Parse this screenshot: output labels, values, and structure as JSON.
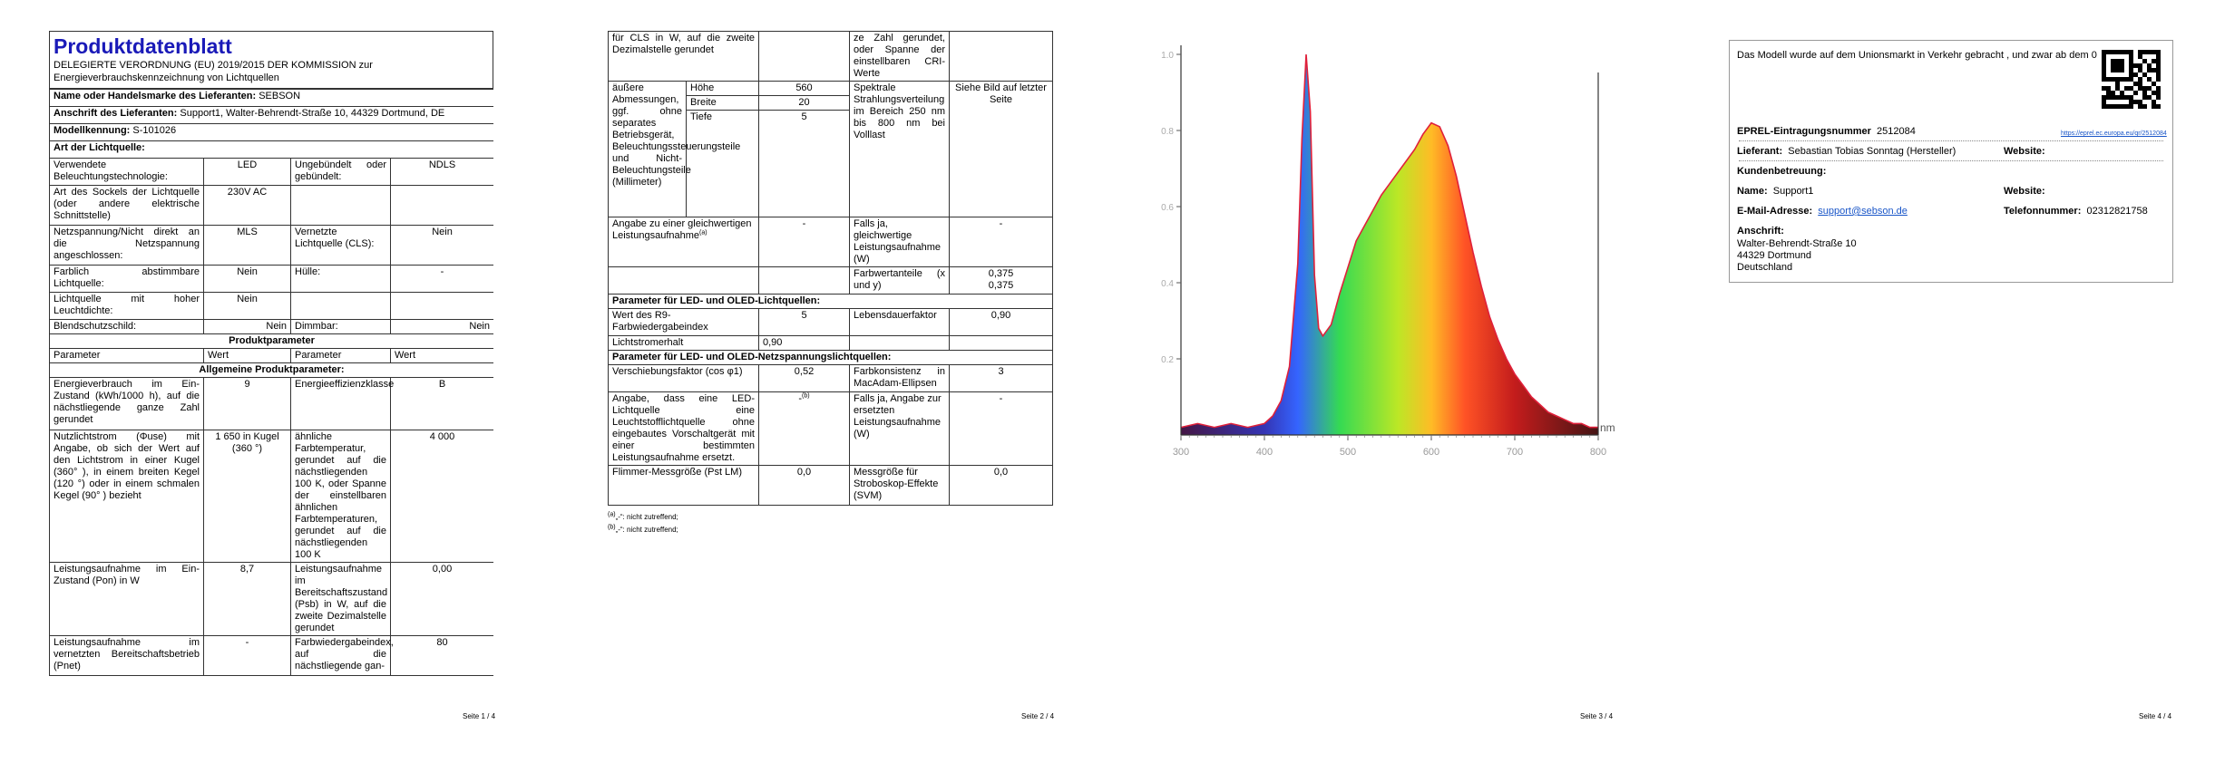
{
  "page1": {
    "title": "Produktdatenblatt",
    "regulation": "DELEGIERTE VERORDNUNG (EU) 2019/2015 DER KOMMISSION zur Energieverbrauchskennzeichnung von Lichtquellen",
    "supplier_name_label": "Name oder Handelsmarke des Lieferanten:",
    "supplier_name": "SEBSON",
    "address_label": "Anschrift des Lieferanten:",
    "address": "Support1, Walter-Behrendt-Straße 10, 44329 Dortmund, DE",
    "model_label": "Modellkennung:",
    "model": "S-101026",
    "light_type_header": "Art der Lichtquelle:",
    "rows": [
      {
        "l1": "Verwendete Beleuchtungstechnologie:",
        "v1": "LED",
        "l2": "Ungebündelt oder gebündelt:",
        "v2": "NDLS"
      },
      {
        "l1": "Art des Sockels der Lichtquelle (oder andere elektrische Schnittstelle)",
        "v1": "230V AC",
        "l2": "",
        "v2": ""
      },
      {
        "l1": "Netzspannung/Nicht direkt an die Netzspannung angeschlossen:",
        "v1": "MLS",
        "l2": "Vernetzte Lichtquelle (CLS):",
        "v2": "Nein"
      },
      {
        "l1": "Farblich abstimmbare Lichtquelle:",
        "v1": "Nein",
        "l2": "Hülle:",
        "v2": "-"
      },
      {
        "l1": "Lichtquelle mit hoher Leuchtdichte:",
        "v1": "Nein",
        "l2": "",
        "v2": ""
      },
      {
        "l1": "Blendschutzschild:",
        "v1": "Nein",
        "l2": "Dimmbar:",
        "v2": "Nein"
      }
    ],
    "product_params_header": "Produktparameter",
    "col_param": "Parameter",
    "col_value": "Wert",
    "general_params_header": "Allgemeine Produktparameter:",
    "general_rows": [
      {
        "l1": "Energieverbrauch im Ein-Zustand (kWh/1000 h), auf die nächstliegende ganze Zahl gerundet",
        "v1": "9",
        "l2": "Energieeffizienzklasse",
        "v2": "B"
      },
      {
        "l1": "Nutzlichtstrom (Φuse) mit Angabe, ob sich der Wert auf den Lichtstrom in einer Kugel (360° ), in einem breiten Kegel (120 °) oder in einem schmalen Kegel (90° ) bezieht",
        "v1": "1 650 in Kugel (360 °)",
        "l2": "ähnliche Farbtemperatur, gerundet auf die nächstliegenden 100 K, oder Spanne der einstellbaren ähnlichen Farbtemperaturen, gerundet auf die nächstliegenden 100 K",
        "v2": "4 000"
      },
      {
        "l1": "Leistungsaufnahme im Ein-Zustand (Pon) in W",
        "v1": "8,7",
        "l2": "Leistungsaufnahme im Bereitschaftszustand (Psb) in W, auf die zweite Dezimalstelle gerundet",
        "v2": "0,00"
      },
      {
        "l1": "Leistungsaufnahme im vernetzten Bereitschaftsbetrieb (Pnet)",
        "v1": "-",
        "l2": "Farbwiedergabeindex, auf die nächstliegende gan-",
        "v2": "80"
      }
    ],
    "footer": "Seite 1 / 4"
  },
  "page2": {
    "top_left": "für CLS in W, auf die zweite Dezimalstelle gerundet",
    "top_right": "ze Zahl gerundet, oder Spanne der einstellbaren CRI-Werte",
    "dims_label": "äußere Abmessungen, ggf. ohne separates Betriebsgerät, Beleuchtungssteuerungsteile und Nicht-Beleuchtungsteile (Millimeter)",
    "dims": [
      {
        "label": "Höhe",
        "value": "560"
      },
      {
        "label": "Breite",
        "value": "20"
      },
      {
        "label": "Tiefe",
        "value": "5"
      }
    ],
    "spectral_label": "Spektrale Strahlungsverteilung im Bereich 250 nm bis 800 nm bei Volllast",
    "spectral_value": "Siehe Bild auf letzter Seite",
    "equiv_label": "Angabe zu einer gleichwertigen Leistungsaufnahme",
    "equiv_value": "-",
    "equiv_power_label": "Falls ja, gleichwertige Leistungsaufnahme (W)",
    "equiv_power_value": "-",
    "chroma_label": "Farbwertanteile (x und y)",
    "chroma_x": "0,375",
    "chroma_y": "0,375",
    "led_header": "Parameter für LED- und OLED-Lichtquellen:",
    "r9_label": "Wert des R9-Farbwiedergabeindex",
    "r9_value": "5",
    "life_label": "Lebensdauerfaktor",
    "life_value": "0,90",
    "maint_label": "Lichtstromerhalt",
    "maint_value": "0,90",
    "mains_header": "Parameter für LED- und OLED-Netzspannungslichtquellen:",
    "shift_label": "Verschiebungsfaktor (cos φ1)",
    "shift_value": "0,52",
    "consistency_label": "Farbkonsistenz in MacAdam-Ellipsen",
    "consistency_value": "3",
    "replace_label": "Angabe, dass eine LED-Lichtquelle eine Leuchtstofflichtquelle ohne eingebautes Vorschaltgerät mit einer bestimmten Leistungsaufnahme ersetzt.",
    "replace_value": "-",
    "replace_power_label": "Falls ja, Angabe zur ersetzten Leistungsaufnahme (W)",
    "replace_power_value": "-",
    "flicker_label": "Flimmer-Messgröße (Pst LM)",
    "flicker_value": "0,0",
    "strobe_label": "Messgröße für Stroboskop-Effekte (SVM)",
    "strobe_value": "0,0",
    "note_a": "„-“: nicht zutreffend;",
    "note_b": "„-“: nicht zutreffend;",
    "footer": "Seite 2 / 4"
  },
  "chart_data": {
    "type": "area",
    "title": "",
    "xlabel": "",
    "ylabel": "",
    "x_ticks": [
      "300",
      "400",
      "500",
      "600",
      "700",
      "800"
    ],
    "y_ticks": [
      "0.2",
      "0.4",
      "0.6",
      "0.8",
      "1.0"
    ],
    "xlim": [
      300,
      800
    ],
    "ylim": [
      0,
      1.0
    ],
    "right_label": "nm",
    "series": [
      {
        "x": [
          300,
          320,
          340,
          360,
          380,
          400,
          410,
          420,
          430,
          440,
          445,
          450,
          455,
          460,
          465,
          470,
          480,
          490,
          500,
          510,
          520,
          530,
          540,
          550,
          560,
          570,
          580,
          590,
          600,
          610,
          620,
          630,
          640,
          650,
          660,
          670,
          680,
          690,
          700,
          710,
          720,
          730,
          740,
          750,
          760,
          770,
          780,
          790,
          800
        ],
        "values": [
          0.02,
          0.03,
          0.02,
          0.03,
          0.02,
          0.03,
          0.05,
          0.09,
          0.18,
          0.45,
          0.78,
          1.0,
          0.85,
          0.42,
          0.28,
          0.26,
          0.29,
          0.37,
          0.44,
          0.51,
          0.55,
          0.59,
          0.63,
          0.66,
          0.69,
          0.72,
          0.75,
          0.79,
          0.82,
          0.81,
          0.76,
          0.68,
          0.58,
          0.48,
          0.39,
          0.31,
          0.25,
          0.2,
          0.16,
          0.13,
          0.1,
          0.08,
          0.06,
          0.05,
          0.04,
          0.03,
          0.03,
          0.02,
          0.02
        ]
      }
    ]
  },
  "page3": {
    "footer": "Seite 3 / 4"
  },
  "page4": {
    "intro": "Das Modell wurde auf dem Unionsmarkt in Verkehr gebracht , und zwar ab dem 0",
    "eprel_label": "EPREL-Eintragungsnummer",
    "eprel_number": "2512084",
    "eprel_link": "https://eprel.ec.europa.eu/qr/2512084",
    "supplier_label": "Lieferant:",
    "supplier": "Sebastian Tobias Sonntag (Hersteller)",
    "website_label": "Website:",
    "customer_service": "Kundenbetreuung:",
    "name_label": "Name:",
    "name": "Support1",
    "website2_label": "Website:",
    "email_label": "E-Mail-Adresse:",
    "email": "support@sebson.de",
    "phone_label": "Telefonnummer:",
    "phone": "02312821758",
    "address_label": "Anschrift:",
    "address_lines": [
      "Walter-Behrendt-Straße 10",
      "44329 Dortmund",
      "Deutschland"
    ],
    "footer": "Seite 4 / 4"
  }
}
